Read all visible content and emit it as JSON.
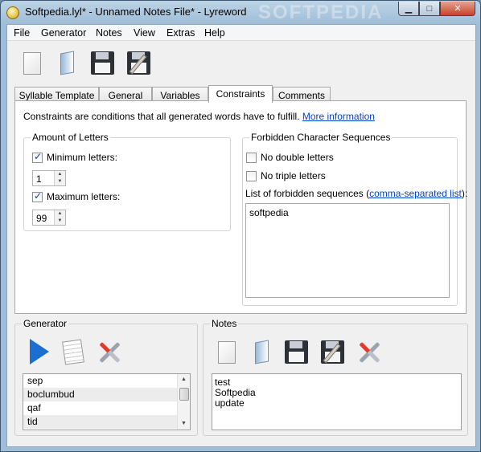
{
  "window": {
    "title": "Softpedia.lyl* - Unnamed Notes File* - Lyreword",
    "watermark": "SOFTPEDIA",
    "minimize": "▁",
    "maximize": "□",
    "close": "✕"
  },
  "menu": [
    "File",
    "Generator",
    "Notes",
    "View",
    "Extras",
    "Help"
  ],
  "toolbar": {
    "icons": [
      "new-file-icon",
      "open-file-icon",
      "save-icon",
      "save-as-icon"
    ]
  },
  "tabs": [
    "Syllable Template",
    "General",
    "Variables",
    "Constraints",
    "Comments"
  ],
  "active_tab": "Constraints",
  "constraints": {
    "intro": "Constraints are conditions that all generated words have to fulfill.",
    "more_info": "More information",
    "amount": {
      "title": "Amount of Letters",
      "min_label": "Minimum letters:",
      "min_checked": true,
      "min_value": "1",
      "max_label": "Maximum letters:",
      "max_checked": true,
      "max_value": "99"
    },
    "forbidden": {
      "title": "Forbidden Character Sequences",
      "no_double": "No double letters",
      "no_double_checked": false,
      "no_triple": "No triple letters",
      "no_triple_checked": false,
      "list_label_prefix": "List of forbidden sequences (",
      "list_label_link": "comma-separated list",
      "list_label_suffix": "):",
      "list_value": "softpedia"
    }
  },
  "generator": {
    "title": "Generator",
    "icons": [
      "play-icon",
      "notepad-icon",
      "tools-icon"
    ],
    "words": [
      "sep",
      "boclumbud",
      "qaf",
      "tid"
    ]
  },
  "notes": {
    "title": "Notes",
    "icons": [
      "new-file-icon",
      "open-file-icon",
      "save-icon",
      "save-as-icon",
      "tools-icon"
    ],
    "lines": [
      "test",
      "Softpedia",
      "update"
    ]
  }
}
